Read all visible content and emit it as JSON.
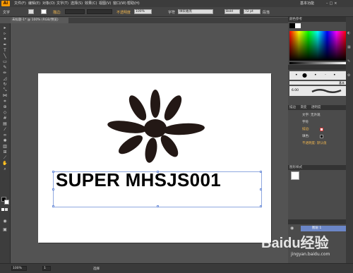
{
  "app": {
    "logo": "Ai",
    "workspace": "基本功能"
  },
  "menus": [
    "文件(F)",
    "编辑(E)",
    "对象(O)",
    "文字(T)",
    "选择(S)",
    "效果(C)",
    "视图(V)",
    "窗口(W)",
    "帮助(H)"
  ],
  "control_bar": {
    "label": "文字",
    "stroke_label": "描边:",
    "opacity_label": "不透明度",
    "opacity_value": "100%",
    "font_label": "字符",
    "font_name": "微软雅黑",
    "font_style": "Bold",
    "font_size": "72 pt",
    "paragraph_label": "段落"
  },
  "document_tab": {
    "title": "未标题-1* @ 100% (RGB/预览)"
  },
  "canvas": {
    "headline": "SUPER MHSJS001"
  },
  "right_panel": {
    "color_tab": "颜色参考",
    "brush_label": "基本",
    "stroke_value": "6.00",
    "tabs": [
      "描边",
      "渐变",
      "透明度"
    ],
    "appearance_title": "文字: 无外观",
    "appearance_rows": [
      "字符",
      "描边:",
      "填色:",
      "不透明度: 默认值"
    ],
    "symbols_title": "图形样式",
    "layer_name": "图层 1"
  },
  "status_bar": {
    "zoom": "100%",
    "page": "1",
    "mode": "选择"
  },
  "watermark": {
    "text": "Baidu经验",
    "url": "jingyan.baidu.com"
  }
}
